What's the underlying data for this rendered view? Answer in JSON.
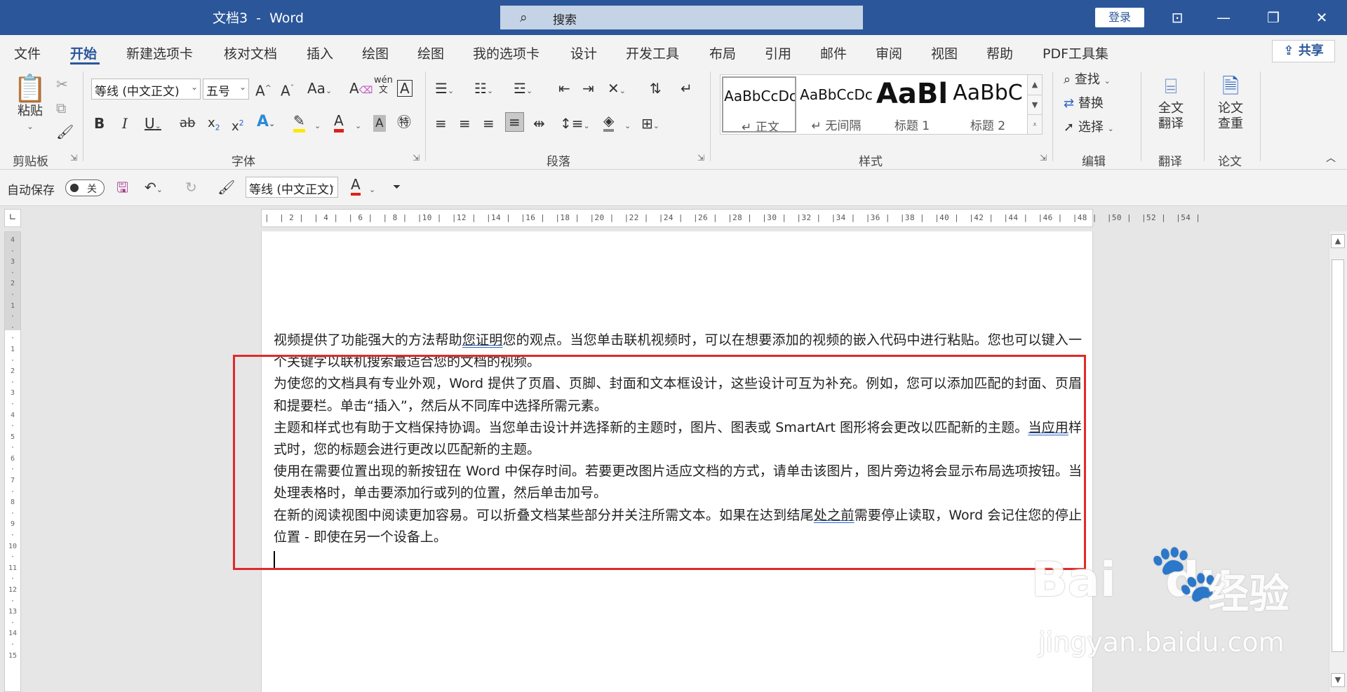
{
  "window": {
    "title": "文档3  -  Word",
    "search_placeholder": "搜索",
    "login_label": "登录"
  },
  "tabs": [
    "文件",
    "开始",
    "新建选项卡",
    "核对文档",
    "插入",
    "绘图",
    "绘图",
    "我的选项卡",
    "设计",
    "开发工具",
    "布局",
    "引用",
    "邮件",
    "审阅",
    "视图",
    "帮助",
    "PDF工具集"
  ],
  "share_label": "共享",
  "ribbon": {
    "clipboard": {
      "paste_label": "粘贴",
      "group_label": "剪贴板"
    },
    "font": {
      "font_name": "等线 (中文正文)",
      "font_size": "五号",
      "group_label": "字体"
    },
    "paragraph": {
      "group_label": "段落"
    },
    "styles": {
      "group_label": "样式",
      "items": [
        {
          "preview": "AaBbCcDc",
          "name": "↵ 正文"
        },
        {
          "preview": "AaBbCcDc",
          "name": "↵ 无间隔"
        },
        {
          "preview": "AaBl",
          "name": "标题 1"
        },
        {
          "preview": "AaBbC",
          "name": "标题 2"
        }
      ]
    },
    "editing": {
      "find_label": "查找",
      "replace_label": "替换",
      "select_label": "选择",
      "group_label": "编辑"
    },
    "translate": {
      "button_label_1": "全文",
      "button_label_2": "翻译",
      "group_label": "翻译"
    },
    "paper": {
      "button_label_1": "论文",
      "button_label_2": "查重",
      "group_label": "论文"
    }
  },
  "qat": {
    "autosave_label": "自动保存",
    "autosave_state": "关",
    "font_name": "等线 (中文正文)"
  },
  "ruler": {
    "horizontal": "|  | 2 |  | 4 |  | 6 |  | 8 |  |10 |  |12 |  |14 |  |16 |  |18 |  |20 |  |22 |  |24 |  |26 |  |28 |  |30 |  |32 |  |34 |  |36 |  |38 |  |40 |  |42 |  |44 |  |46 |  |48 |  |50 |  |52 |  |54 |",
    "vertical": "4\n·\n3\n·\n2\n·\n1\n·\n·\n·\n1\n·\n2\n·\n3\n·\n4\n·\n5\n·\n6\n·\n7\n·\n8\n·\n9\n·\n10\n·\n11\n·\n12\n·\n13\n·\n14\n·\n15"
  },
  "document": {
    "p1_a": "视频提供了功能强大的方法帮助",
    "p1_u": "您证明",
    "p1_b": "您的观点。当您单击联机视频时，可以在想要添加的视频的嵌入代码中进行粘贴。您也可以键入一个关键字以联机搜索最适合您的文档的视频。",
    "p2": "为使您的文档具有专业外观，Word 提供了页眉、页脚、封面和文本框设计，这些设计可互为补充。例如，您可以添加匹配的封面、页眉和提要栏。单击“插入”，然后从不同库中选择所需元素。",
    "p3_a": "主题和样式也有助于文档保持协调。当您单击设计并选择新的主题时，图片、图表或 SmartArt 图形将会更改以匹配新的主题。",
    "p3_u": "当应用",
    "p3_b": "样式时，您的标题会进行更改以匹配新的主题。",
    "p4": "使用在需要位置出现的新按钮在 Word 中保存时间。若要更改图片适应文档的方式，请单击该图片，图片旁边将会显示布局选项按钮。当处理表格时，单击要添加行或列的位置，然后单击加号。",
    "p5_a": "在新的阅读视图中阅读更加容易。可以折叠文档某些部分并关注所需文本。如果在达到结尾",
    "p5_u": "处之前",
    "p5_b": "需要停止读取，Word 会记住您的停止位置 - 即使在另一个设备上。"
  },
  "watermark": {
    "logo": "Bai",
    "logo_tail": "du",
    "brand_cn": "经验",
    "url": "jingyan.baidu.com"
  },
  "colors": {
    "titlebar": "#2b579a",
    "highlight_box": "#e02a2a",
    "font_color_bar": "#e0201a",
    "highlighter_bar": "#ffe800"
  }
}
